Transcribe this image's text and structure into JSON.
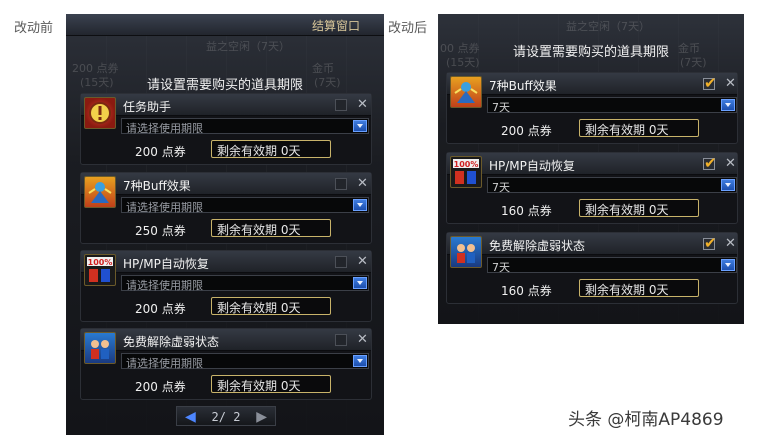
{
  "captions": {
    "before": "改动前",
    "after": "改动后"
  },
  "before_panel": {
    "checkout_window": "结算窗口",
    "prompt": "请设置需要购买的道具期限",
    "ghost_text": [
      "益之空闲（7天）",
      "200 点券",
      "(15天)",
      "金币",
      "(7天)"
    ],
    "items": [
      {
        "name": "任务助手",
        "icon": "task-helper-icon",
        "select_value": "请选择使用期限",
        "price": "200 点券",
        "remaining": "剩余有效期 0天",
        "checked": false
      },
      {
        "name": "7种Buff效果",
        "icon": "buff-effect-icon",
        "select_value": "请选择使用期限",
        "price": "250 点券",
        "remaining": "剩余有效期 0天",
        "checked": false
      },
      {
        "name": "HP/MP自动恢复",
        "icon": "hp-mp-recovery-icon",
        "select_value": "请选择使用期限",
        "price": "200 点券",
        "remaining": "剩余有效期 0天",
        "checked": false
      },
      {
        "name": "免费解除虚弱状态",
        "icon": "remove-weakness-icon",
        "select_value": "请选择使用期限",
        "price": "200 点券",
        "remaining": "剩余有效期 0天",
        "checked": false
      }
    ],
    "pager": {
      "current": 2,
      "total": 2,
      "text": "2/ 2"
    }
  },
  "after_panel": {
    "prompt": "请设置需要购买的道具期限",
    "ghost_text": [
      "益之空闲（7天）",
      "00 点券",
      "(15天)",
      "金币",
      "(7天)"
    ],
    "items": [
      {
        "name": "7种Buff效果",
        "icon": "buff-effect-icon",
        "select_value": "7天",
        "price": "200 点券",
        "remaining": "剩余有效期 0天",
        "checked": true
      },
      {
        "name": "HP/MP自动恢复",
        "icon": "hp-mp-recovery-icon",
        "select_value": "7天",
        "price": "160 点券",
        "remaining": "剩余有效期 0天",
        "checked": true
      },
      {
        "name": "免费解除虚弱状态",
        "icon": "remove-weakness-icon",
        "select_value": "7天",
        "price": "160 点券",
        "remaining": "剩余有效期 0天",
        "checked": true
      }
    ]
  },
  "watermark": "头条 @柯南AP4869",
  "colors": {
    "accent_blue": "#2f6fe0",
    "gold_border": "#c8b36a",
    "check_orange": "#f0b02a",
    "panel_bg": "#1b1d22"
  }
}
